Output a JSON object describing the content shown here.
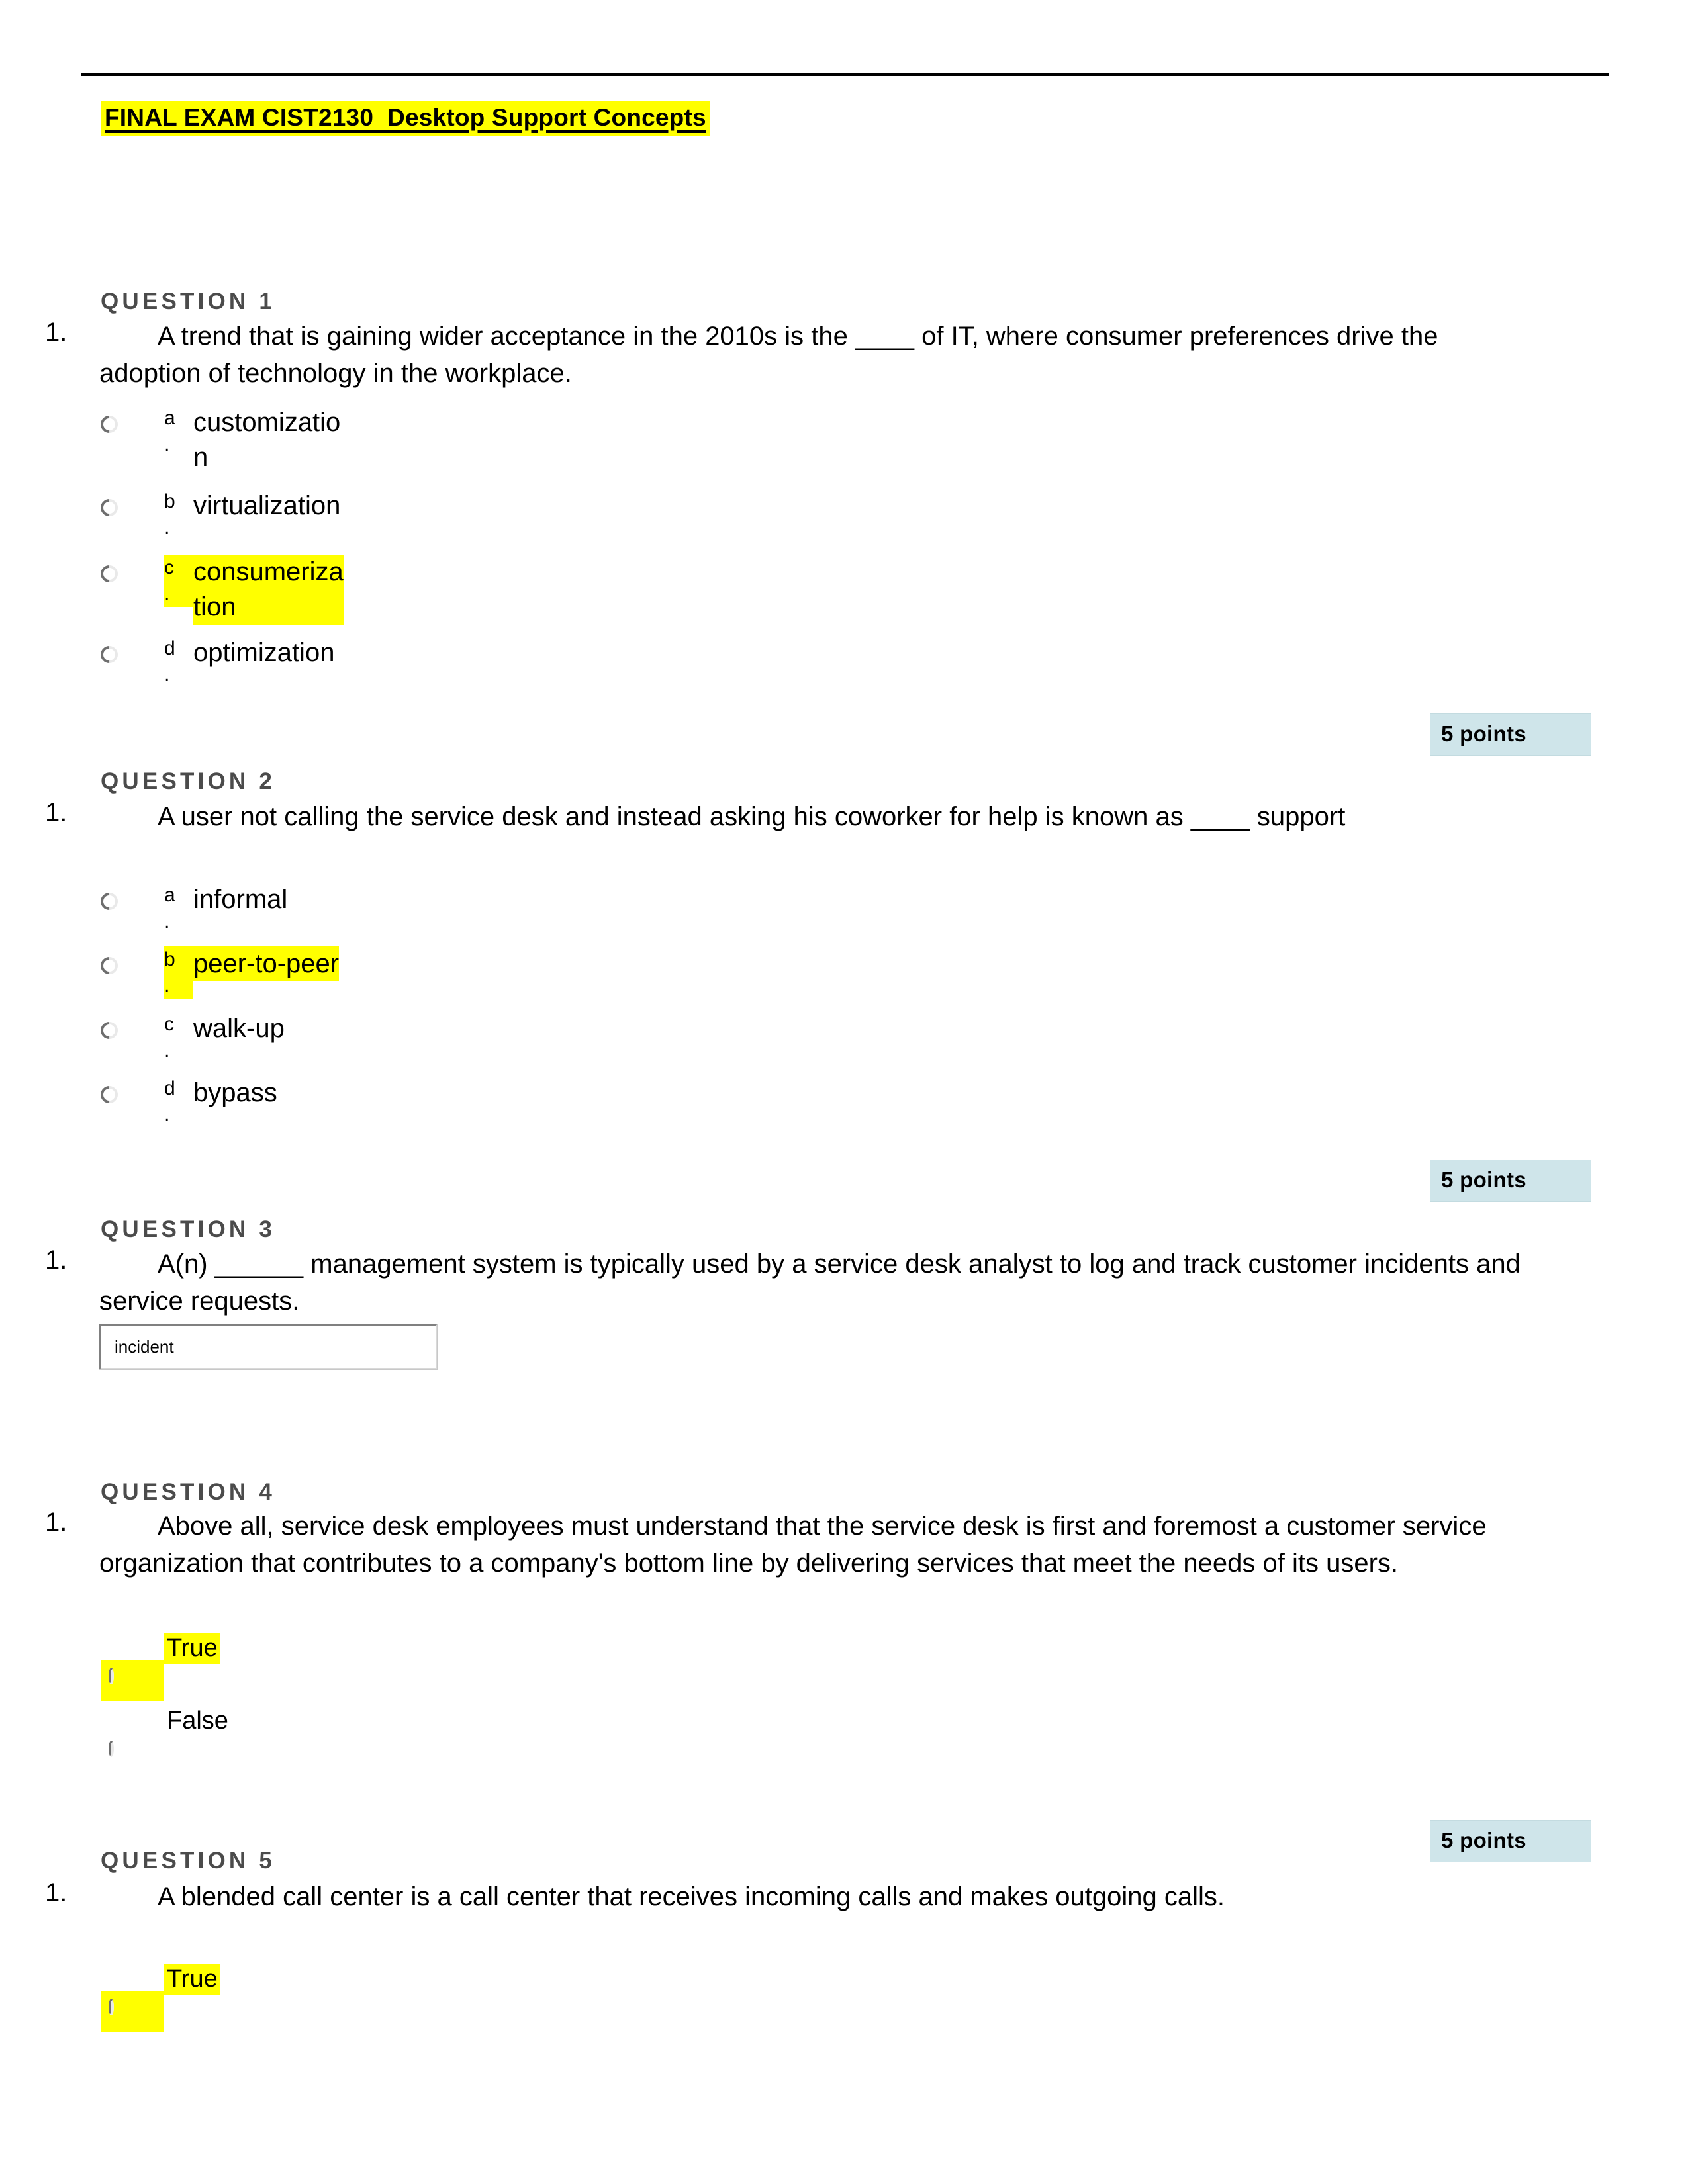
{
  "document": {
    "title": "FINAL EXAM CIST2130  Desktop Support Concepts",
    "highlight_color": "#ffff00",
    "points_badge_color": "#cfe5ea"
  },
  "questions": [
    {
      "label": "QUESTION 1",
      "number": "1.",
      "text": "A trend that is gaining wider acceptance in the 2010s is the ____ of IT, where consumer preferences drive the adoption of technology in the workplace.",
      "type": "multiple-choice",
      "options": [
        {
          "letter": "a\n.",
          "text": "customizatio\nn",
          "highlighted": false
        },
        {
          "letter": "b\n.",
          "text": "virtualization",
          "highlighted": false
        },
        {
          "letter": "c\n.",
          "text": "consumeriza\ntion",
          "highlighted": true
        },
        {
          "letter": "d\n.",
          "text": "optimization",
          "highlighted": false
        }
      ],
      "points": "5 points"
    },
    {
      "label": "QUESTION 2",
      "number": "1.",
      "text": "A user not calling the service desk and instead asking his coworker for help is known as ____ support",
      "type": "multiple-choice",
      "options": [
        {
          "letter": "a\n.",
          "text": "informal",
          "highlighted": false
        },
        {
          "letter": "b\n.",
          "text": "peer-to-peer",
          "highlighted": true
        },
        {
          "letter": "c\n.",
          "text": "walk-up",
          "highlighted": false
        },
        {
          "letter": "d\n.",
          "text": "bypass",
          "highlighted": false
        }
      ],
      "points": "5 points"
    },
    {
      "label": "QUESTION 3",
      "number": "1.",
      "text": "A(n) ______ management system is typically used by a service desk analyst to log and track customer incidents and service requests.",
      "type": "fill-in-blank",
      "answer_value": "incident",
      "answer_placeholder": "",
      "points": ""
    },
    {
      "label": "QUESTION 4",
      "number": "1.",
      "text": "Above all, service desk employees must understand that the service desk is first and foremost a customer service organization that contributes to a company's bottom line by delivering services that meet the needs of its users.",
      "type": "true-false",
      "options": [
        {
          "text": "True",
          "highlighted": true
        },
        {
          "text": "False",
          "highlighted": false
        }
      ],
      "points": "5 points"
    },
    {
      "label": "QUESTION 5",
      "number": "1.",
      "text": "A blended call center is a call center that receives incoming calls and makes outgoing calls.",
      "type": "true-false",
      "options": [
        {
          "text": "True",
          "highlighted": true
        }
      ],
      "points": ""
    }
  ]
}
